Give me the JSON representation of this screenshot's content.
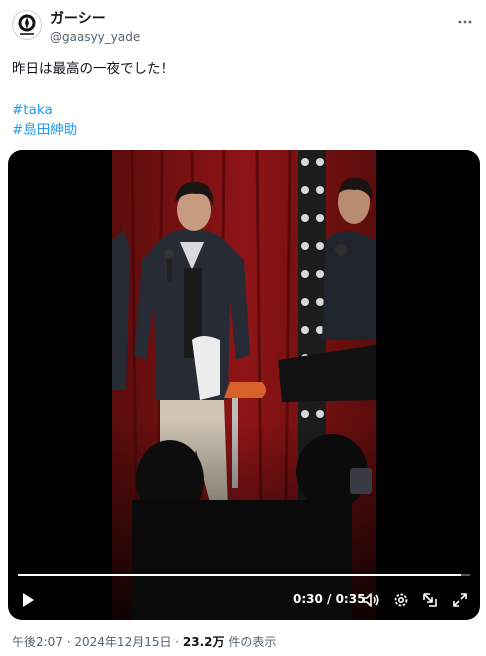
{
  "account": {
    "display_name": "ガーシー",
    "handle": "@gaasyy_yade",
    "avatar_icon": "emblem-avatar-icon"
  },
  "tweet": {
    "text": "昨日は最高の一夜でした！",
    "hashtags": [
      "#taka",
      "#島田紳助"
    ]
  },
  "video": {
    "time_readout": "0:30 / 0:35",
    "progress": 0.98,
    "icons": [
      "play-icon",
      "volume-icon",
      "gear-icon",
      "picture-in-picture-icon",
      "fullscreen-icon"
    ]
  },
  "footer": {
    "time_date": "午後2:07 · 2024年12月15日 · ",
    "view_count": "23.2万",
    "view_label": " 件の表示"
  },
  "colors": {
    "link": "#1d9bf0",
    "secondary_text": "#536471",
    "video_background": "#000000"
  }
}
